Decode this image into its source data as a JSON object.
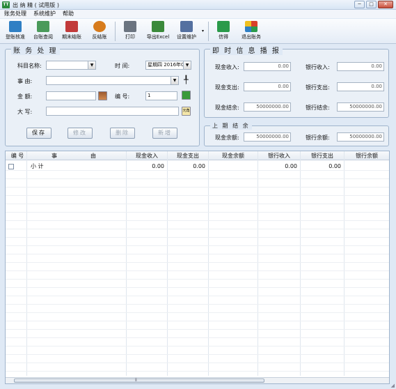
{
  "window": {
    "title": "出 纳 精 ( 试用版 )",
    "app_icon": "TT",
    "minimize": "─",
    "maximize": "□",
    "close": "✕"
  },
  "menu": [
    "账务处理",
    "系统维护",
    "帮助"
  ],
  "toolbar": [
    {
      "label": "登账核准",
      "icon": "approve-icon",
      "color": "#2f7fc4"
    },
    {
      "label": "台账查阅",
      "icon": "view-ledger-icon",
      "color": "#4a9a5a"
    },
    {
      "label": "期末结账",
      "icon": "period-close-icon",
      "color": "#c23a3a"
    },
    {
      "label": "反结账",
      "icon": "reverse-close-icon",
      "color": "#d77b1c"
    },
    {
      "label": "打印",
      "icon": "printer-icon",
      "color": "#6b7480"
    },
    {
      "label": "导出Excel",
      "icon": "excel-export-icon",
      "color": "#3b8a3b"
    },
    {
      "label": "设置维护",
      "icon": "settings-icon",
      "color": "#5470a0"
    },
    {
      "label": "信得",
      "icon": "book-icon",
      "color": "#2a9a4a"
    },
    {
      "label": "退出账务",
      "icon": "exit-icon",
      "color": "#d8402a"
    }
  ],
  "toolbar_dropdown": "▾",
  "account_panel": {
    "title": "账 务 处 理",
    "subject_label": "科目名称:",
    "subject_value": "",
    "time_label": "时    间:",
    "time_value": "星期四 2016年0",
    "reason_label": "事    由:",
    "reason_value": "",
    "amount_label": "金    额:",
    "amount_value": "",
    "number_label": "编    号:",
    "number_value": "1",
    "upper_label": "大    写:",
    "upper_value": "",
    "upper_icon_text": "元角",
    "pin": "╀",
    "buttons": {
      "save": "保存",
      "edit": "修改",
      "delete": "删除",
      "add": "新增"
    }
  },
  "info_panel": {
    "title": "即 时 信 息 播 报",
    "cash_income_label": "现金收入:",
    "cash_income": "0.00",
    "bank_income_label": "银行收入:",
    "bank_income": "0.00",
    "cash_expense_label": "现金支出:",
    "cash_expense": "0.00",
    "bank_expense_label": "银行支出:",
    "bank_expense": "0.00",
    "cash_balance_label": "现金结余:",
    "cash_balance": "50000000.00",
    "bank_balance_label": "银行结余:",
    "bank_balance": "50000000.00"
  },
  "prev_panel": {
    "title": "上 期 结 余",
    "cash_label": "现金余额:",
    "cash": "50000000.00",
    "bank_label": "银行余额:",
    "bank": "50000000.00"
  },
  "grid": {
    "columns": [
      "编 号",
      "事",
      "由",
      "现金收入",
      "现金支出",
      "现金余额",
      "银行收入",
      "银行支出",
      "银行余额"
    ],
    "subtotal": {
      "label": "小 计",
      "cash_income": "0.00",
      "cash_expense": "0.00",
      "bank_income": "0.00",
      "bank_expense": "0.00"
    },
    "scroll_mark": "⦀"
  }
}
